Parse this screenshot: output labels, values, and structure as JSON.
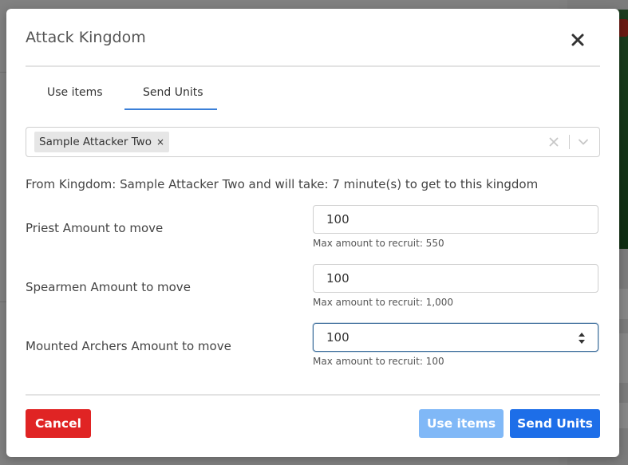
{
  "modal": {
    "title": "Attack Kingdom",
    "close_icon": "close-icon"
  },
  "tabs": [
    {
      "label": "Use items",
      "active": false
    },
    {
      "label": "Send Units",
      "active": true
    }
  ],
  "kingdom_select": {
    "selected": "Sample Attacker Two",
    "remove_glyph": "×"
  },
  "info": {
    "text": "From Kingdom: Sample Attacker Two and will take: 7 minute(s) to get to this kingdom"
  },
  "units": [
    {
      "label": "Priest Amount to move",
      "value": "100",
      "help": "Max amount to recruit: 550"
    },
    {
      "label": "Spearmen Amount to move",
      "value": "100",
      "help": "Max amount to recruit: 1,000"
    },
    {
      "label": "Mounted Archers Amount to move",
      "value": "100",
      "help": "Max amount to recruit: 100"
    }
  ],
  "footer": {
    "cancel_label": "Cancel",
    "use_items_label": "Use items",
    "send_units_label": "Send Units"
  },
  "colors": {
    "accent": "#1d6ee8",
    "accent_light": "#80b8f7",
    "danger": "#e02424",
    "tab_underline": "#3b7fd8"
  }
}
